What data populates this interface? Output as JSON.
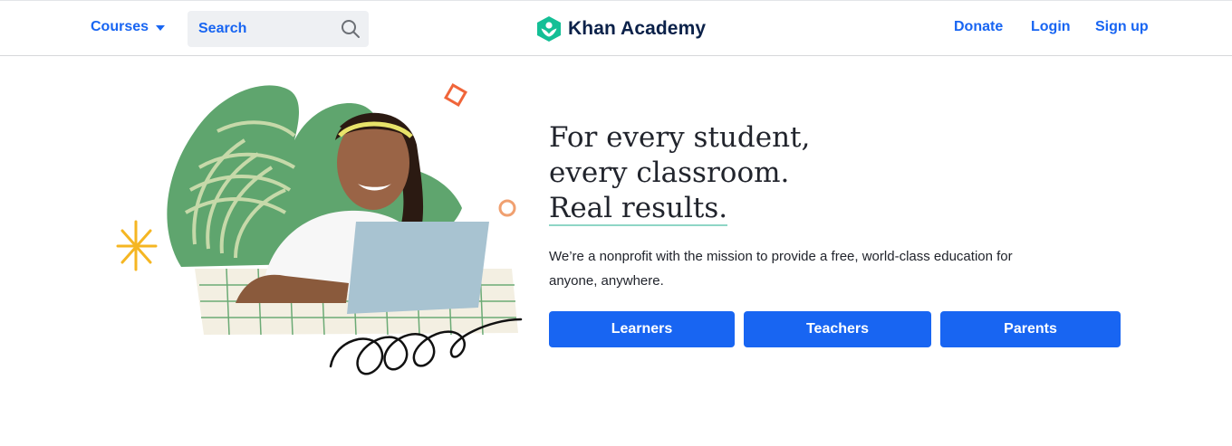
{
  "header": {
    "courses_label": "Courses",
    "search_placeholder": "Search",
    "logo_text": "Khan Academy",
    "donate_label": "Donate",
    "login_label": "Login",
    "signup_label": "Sign up"
  },
  "hero": {
    "headline_line1": "For every student,",
    "headline_line2": "every classroom.",
    "headline_line3": "Real results.",
    "mission_text": "We’re a nonprofit with the mission to provide a free, world-class education for anyone, anywhere.",
    "buttons": {
      "learners": "Learners",
      "teachers": "Teachers",
      "parents": "Parents"
    }
  },
  "colors": {
    "brand_blue": "#1865f2",
    "logo_green": "#14bf96",
    "logo_navy": "#0b2149",
    "text": "#21242c"
  },
  "icons": {
    "courses_caret": "caret-down-icon",
    "search": "search-icon",
    "logo_mark": "khan-academy-hexagon-logo"
  }
}
